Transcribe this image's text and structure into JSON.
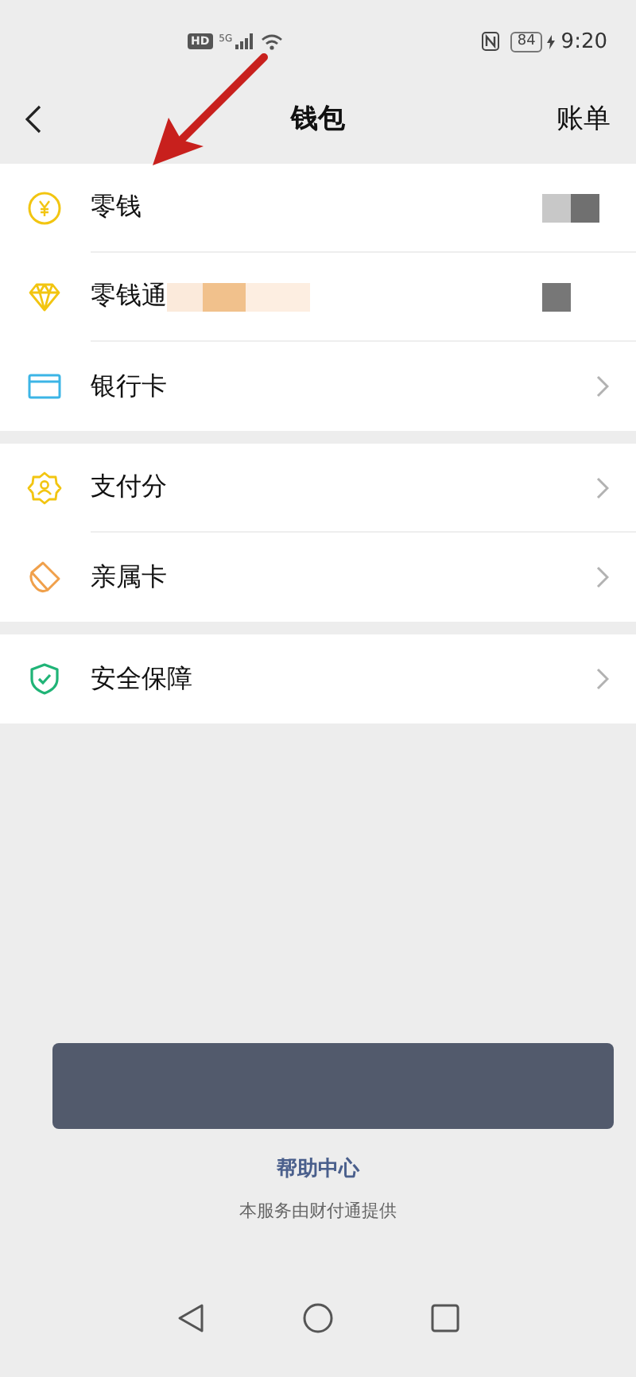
{
  "status_bar": {
    "hd": "HD",
    "network": "5G",
    "battery": "84",
    "time": "9:20"
  },
  "header": {
    "title": "钱包",
    "action": "账单"
  },
  "groups": [
    {
      "rows": [
        {
          "label": "零钱",
          "kind": "mask",
          "label_redacted": false
        },
        {
          "label": "零钱通",
          "kind": "block",
          "label_redacted": true
        },
        {
          "label": "银行卡",
          "kind": "chevron",
          "label_redacted": false
        }
      ]
    },
    {
      "rows": [
        {
          "label": "支付分",
          "kind": "chevron",
          "label_redacted": false
        },
        {
          "label": "亲属卡",
          "kind": "chevron",
          "label_redacted": false
        }
      ]
    },
    {
      "rows": [
        {
          "label": "安全保障",
          "kind": "chevron",
          "label_redacted": false
        }
      ]
    }
  ],
  "banner": {
    "kind": "redacted"
  },
  "footer": {
    "link": "帮助中心",
    "note": "本服务由财付通提供"
  }
}
